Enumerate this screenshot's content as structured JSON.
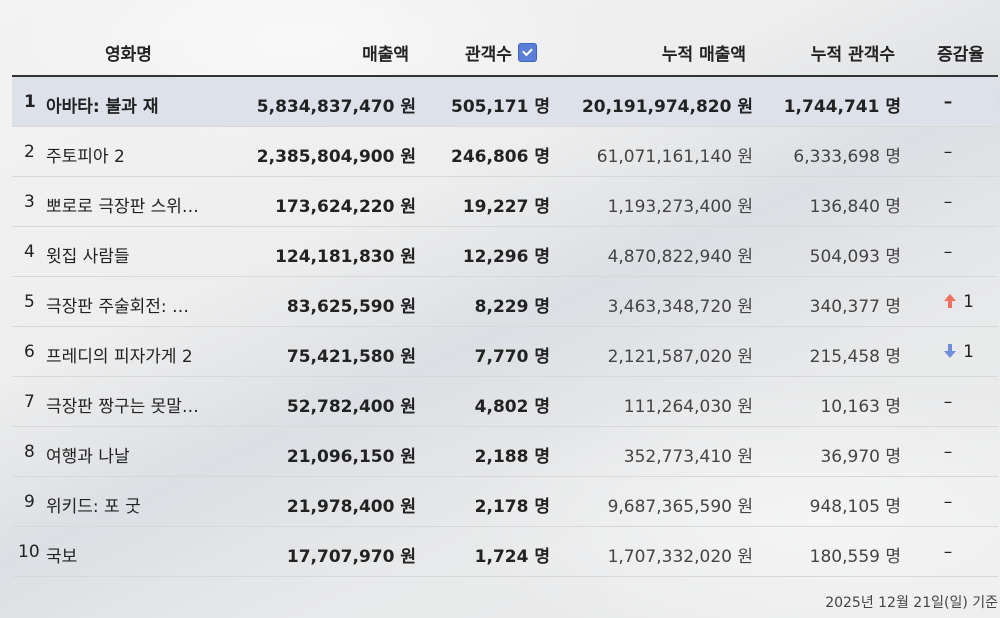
{
  "table": {
    "headers": {
      "title": "영화명",
      "sales": "매출액",
      "audience": "관객수",
      "cum_sales": "누적 매출액",
      "cum_audience": "누적 관객수",
      "change": "증감율"
    },
    "rows": [
      {
        "rank": "1",
        "title": "아바타: 불과 재",
        "sales": "5,834,837,470 원",
        "audience": "505,171 명",
        "cum_sales": "20,191,974,820 원",
        "cum_audience": "1,744,741 명",
        "change": "–",
        "change_num": ""
      },
      {
        "rank": "2",
        "title": "주토피아 2",
        "sales": "2,385,804,900 원",
        "audience": "246,806 명",
        "cum_sales": "61,071,161,140 원",
        "cum_audience": "6,333,698 명",
        "change": "–",
        "change_num": ""
      },
      {
        "rank": "3",
        "title": "뽀로로 극장판 스위…",
        "sales": "173,624,220 원",
        "audience": "19,227 명",
        "cum_sales": "1,193,273,400 원",
        "cum_audience": "136,840 명",
        "change": "–",
        "change_num": ""
      },
      {
        "rank": "4",
        "title": "윗집 사람들",
        "sales": "124,181,830 원",
        "audience": "12,296 명",
        "cum_sales": "4,870,822,940 원",
        "cum_audience": "504,093 명",
        "change": "–",
        "change_num": ""
      },
      {
        "rank": "5",
        "title": "극장판 주술회전: …",
        "sales": "83,625,590 원",
        "audience": "8,229 명",
        "cum_sales": "3,463,348,720 원",
        "cum_audience": "340,377 명",
        "change": "up",
        "change_num": "1"
      },
      {
        "rank": "6",
        "title": "프레디의 피자가게 2",
        "sales": "75,421,580 원",
        "audience": "7,770 명",
        "cum_sales": "2,121,587,020 원",
        "cum_audience": "215,458 명",
        "change": "down",
        "change_num": "1"
      },
      {
        "rank": "7",
        "title": "극장판 짱구는 못말…",
        "sales": "52,782,400 원",
        "audience": "4,802 명",
        "cum_sales": "111,264,030 원",
        "cum_audience": "10,163 명",
        "change": "–",
        "change_num": ""
      },
      {
        "rank": "8",
        "title": "여행과 나날",
        "sales": "21,096,150 원",
        "audience": "2,188 명",
        "cum_sales": "352,773,410 원",
        "cum_audience": "36,970 명",
        "change": "–",
        "change_num": ""
      },
      {
        "rank": "9",
        "title": "위키드: 포 굿",
        "sales": "21,978,400 원",
        "audience": "2,178 명",
        "cum_sales": "9,687,365,590 원",
        "cum_audience": "948,105 명",
        "change": "–",
        "change_num": ""
      },
      {
        "rank": "10",
        "title": "국보",
        "sales": "17,707,970 원",
        "audience": "1,724 명",
        "cum_sales": "1,707,332,020 원",
        "cum_audience": "180,559 명",
        "change": "–",
        "change_num": ""
      }
    ]
  },
  "footer": {
    "date_text": "2025년 12월 21일(일) 기준"
  },
  "colors": {
    "highlight_row": "#dde1ea",
    "sort_button": "#5b7fd6",
    "up_arrow": "#f07060",
    "down_arrow": "#6f8fdc"
  }
}
